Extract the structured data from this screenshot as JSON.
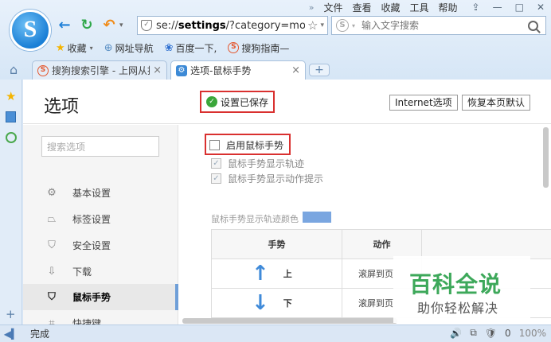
{
  "browser": {
    "logo_glyph": "S",
    "menu": [
      "文件",
      "查看",
      "收藏",
      "工具",
      "帮助"
    ],
    "menu_chevron": "»",
    "window_controls": [
      "⇪",
      "—",
      "□",
      "✕"
    ],
    "address": {
      "prefix": "se://",
      "bold": "settings",
      "suffix": "/?category=mo"
    },
    "search_placeholder": "输入文字搜索",
    "bookmarks": [
      {
        "label": "收藏",
        "icon": "star-icon"
      },
      {
        "label": "网址导航",
        "icon": "globe-icon"
      },
      {
        "label": "百度一下,",
        "icon": "paw-icon"
      },
      {
        "label": "搜狗指南—",
        "icon": "sogou-icon"
      }
    ],
    "tabs": [
      {
        "label": "搜狗搜索引擎 - 上网从搜",
        "active": false
      },
      {
        "label": "选项-鼠标手势",
        "active": true
      }
    ],
    "new_tab_label": "+"
  },
  "page": {
    "title": "选项",
    "saved_status": "设置已保存",
    "buttons": [
      "Internet选项",
      "恢复本页默认"
    ],
    "sidebar_search_placeholder": "搜索选项",
    "sidebar": [
      {
        "label": "基本设置",
        "icon": "gear-icon",
        "glyph": "⚙",
        "active": false
      },
      {
        "label": "标签设置",
        "icon": "tab-icon",
        "glyph": "⏢",
        "active": false
      },
      {
        "label": "安全设置",
        "icon": "shield-icon",
        "glyph": "⛉",
        "active": false
      },
      {
        "label": "下载",
        "icon": "download-icon",
        "glyph": "⇩",
        "active": false
      },
      {
        "label": "鼠标手势",
        "icon": "mouse-icon",
        "glyph": "⛉",
        "active": true
      },
      {
        "label": "快捷键",
        "icon": "shortcut-icon",
        "glyph": "⌗",
        "active": false
      }
    ],
    "checkboxes": {
      "enable": {
        "label": "启用鼠标手势",
        "checked": false
      },
      "show_trail": {
        "label": "鼠标手势显示轨迹",
        "checked": true
      },
      "show_hint": {
        "label": "鼠标手势显示动作提示",
        "checked": true
      }
    },
    "trail_color_label": "鼠标手势显示轨迹颜色",
    "trail_color": "#7aa6e0",
    "table": {
      "headers": [
        "手势",
        "动作"
      ],
      "rows": [
        {
          "arrow": "↑",
          "direction": "上",
          "action": "滚屏到页"
        },
        {
          "arrow": "↓",
          "direction": "下",
          "action": "滚屏到页"
        }
      ]
    }
  },
  "watermark": {
    "big": "百科全说",
    "small": "助你轻松解决"
  },
  "status": {
    "text": "完成",
    "right": [
      "🔊",
      "⧉",
      "🛡",
      "0",
      "100%"
    ]
  },
  "colors": {
    "accent": "#3f8ad9",
    "highlight": "#d9302f",
    "ok": "#3aa63a",
    "watermark": "#3da85a"
  }
}
